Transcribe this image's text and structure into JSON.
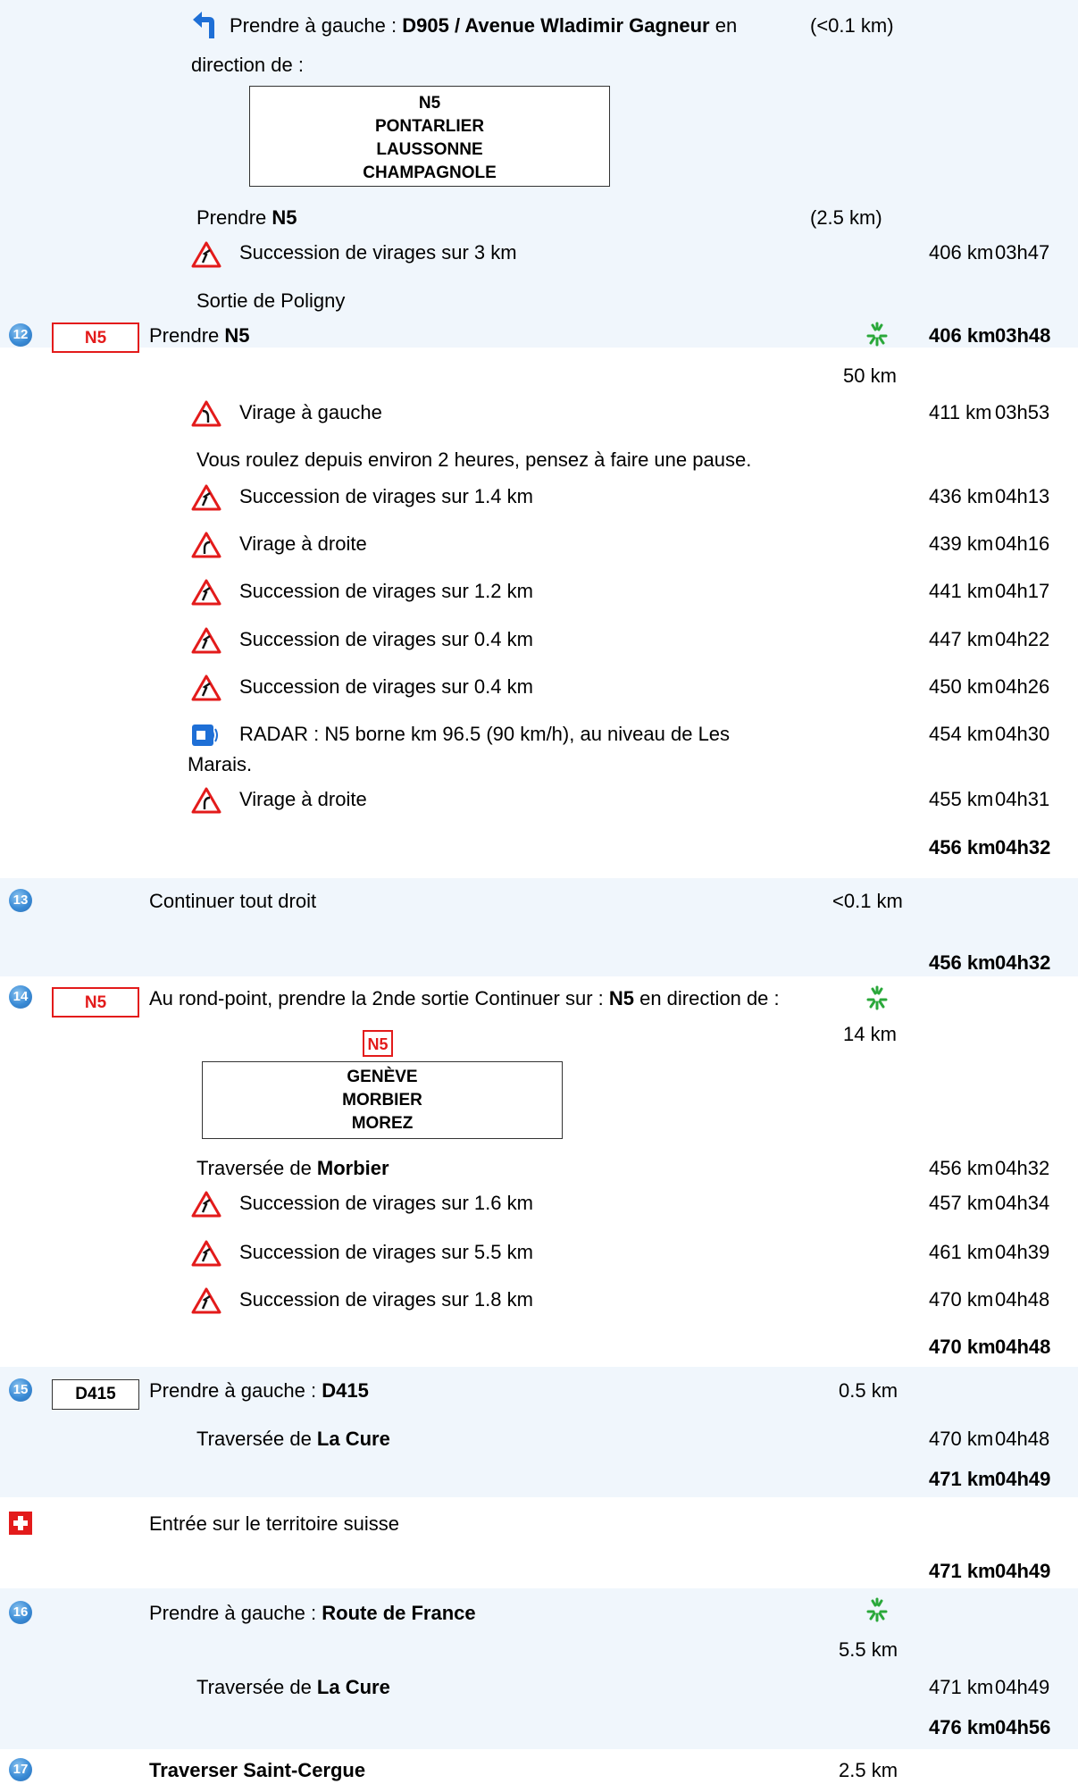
{
  "step11_cont": {
    "turn_text": "Prendre à gauche : ",
    "turn_road": "D905 / Avenue Wladimir Gagneur",
    "turn_en": " en",
    "turn_dist": "(<0.1 km)",
    "direction_label": "direction de :",
    "sign_lines": [
      "N5",
      "PONTARLIER",
      "LAUSSONNE",
      "CHAMPAGNOLE"
    ],
    "take_text": "Prendre ",
    "take_road": "N5",
    "take_dist": "(2.5 km)",
    "alert_text": "Succession de virages sur 3 km",
    "alert_km": "406 km",
    "alert_time": "03h47",
    "exit_text": "Sortie de Poligny"
  },
  "step12": {
    "number": "12",
    "road_badge": "N5",
    "text": "Prendre ",
    "road": "N5",
    "segment_dist": "50 km",
    "km": "406 km",
    "time": "03h48",
    "events": [
      {
        "text": "Virage à gauche",
        "km": "411 km",
        "time": "03h53",
        "icon": "left-curve-warning-icon"
      },
      {
        "text": "Vous roulez depuis environ 2 heures, pensez à faire une pause.",
        "km": "",
        "time": ""
      },
      {
        "text": "Succession de virages sur 1.4 km",
        "km": "436 km",
        "time": "04h13",
        "icon": "winding-road-warning-icon"
      },
      {
        "text": "Virage à droite",
        "km": "439 km",
        "time": "04h16",
        "icon": "right-curve-warning-icon"
      },
      {
        "text": "Succession de virages sur 1.2 km",
        "km": "441 km",
        "time": "04h17",
        "icon": "winding-road-warning-icon"
      },
      {
        "text": "Succession de virages sur 0.4 km",
        "km": "447 km",
        "time": "04h22",
        "icon": "winding-road-warning-icon"
      },
      {
        "text": "Succession de virages sur 0.4 km",
        "km": "450 km",
        "time": "04h26",
        "icon": "winding-road-warning-icon"
      },
      {
        "text": "RADAR : N5 borne km 96.5 (90 km/h), au niveau de Les",
        "text2": "Marais.",
        "km": "454 km",
        "time": "04h30",
        "icon": "speed-camera-icon"
      },
      {
        "text": "Virage à droite",
        "km": "455 km",
        "time": "04h31",
        "icon": "right-curve-warning-icon"
      }
    ],
    "end_km": "456 km",
    "end_time": "04h32"
  },
  "step13": {
    "number": "13",
    "text": "Continuer tout droit",
    "segment_dist": "<0.1 km",
    "end_km": "456 km",
    "end_time": "04h32"
  },
  "step14": {
    "number": "14",
    "road_badge": "N5",
    "text": "Au rond-point, prendre la 2nde sortie Continuer sur : ",
    "road": "N5",
    "text_after": " en direction de :",
    "segment_dist": "14 km",
    "sign_badge": "N5",
    "sign_lines": [
      "GENÈVE",
      "MORBIER",
      "MOREZ"
    ],
    "events": [
      {
        "prefix": "Traversée de ",
        "place": "Morbier",
        "km": "456 km",
        "time": "04h32"
      },
      {
        "text": "Succession de virages sur 1.6 km",
        "km": "457 km",
        "time": "04h34",
        "icon": "winding-road-warning-icon"
      },
      {
        "text": "Succession de virages sur 5.5 km",
        "km": "461 km",
        "time": "04h39",
        "icon": "winding-road-warning-icon"
      },
      {
        "text": "Succession de virages sur 1.8 km",
        "km": "470 km",
        "time": "04h48",
        "icon": "winding-road-warning-icon"
      }
    ],
    "end_km": "470 km",
    "end_time": "04h48"
  },
  "step15": {
    "number": "15",
    "road_badge": "D415",
    "text": "Prendre à gauche : ",
    "road": "D415",
    "segment_dist": "0.5 km",
    "cross_prefix": "Traversée de ",
    "cross_place": "La Cure",
    "cross_km": "470 km",
    "cross_time": "04h48",
    "end_km": "471 km",
    "end_time": "04h49"
  },
  "border": {
    "text": "Entrée sur le territoire suisse",
    "end_km": "471 km",
    "end_time": "04h49"
  },
  "step16": {
    "number": "16",
    "text": "Prendre à gauche : ",
    "road": "Route de France",
    "segment_dist": "5.5 km",
    "cross_prefix": "Traversée de ",
    "cross_place": "La Cure",
    "cross_km": "471 km",
    "cross_time": "04h49",
    "end_km": "476 km",
    "end_time": "04h56"
  },
  "step17": {
    "number": "17",
    "text": "Traverser Saint-Cergue",
    "segment_dist": "2.5 km"
  },
  "colors": {
    "band": "#f0f6fc",
    "road_badge_red": "#e31b1b",
    "step_number": "#3a8bd6",
    "swiss_flag": "#e31b1b"
  }
}
